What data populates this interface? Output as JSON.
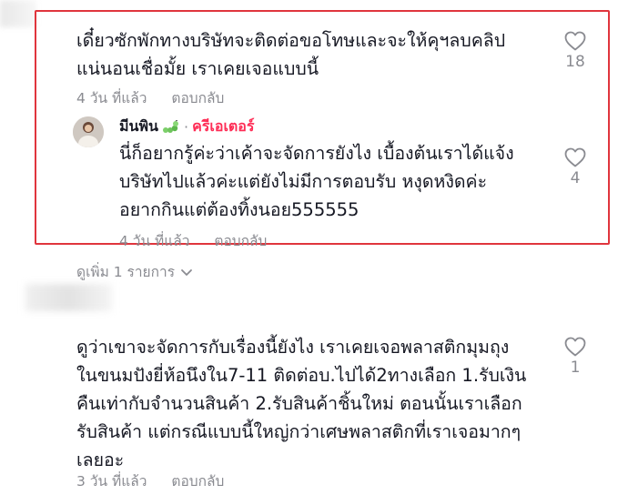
{
  "comment1": {
    "text_line1": "เดี๋ยวซักพักทางบริษัทจะติดต่อขอโทษและจะให้คุฯลบคลิป",
    "text_line2": "แน่นอนเชื่อมั้ย เราเคยเจอแบบนี้",
    "time": "4 วัน ที่แล้ว",
    "reply_label": "ตอบกลับ",
    "likes": "18"
  },
  "reply1": {
    "author": "มีนพิน",
    "separator": "·",
    "creator_badge": "ครีเอเตอร์",
    "text_line1": "นี่ก็อยากรู้ค่ะว่าเค้าจะจัดการยังไง เบื้องต้นเราได้แจ้ง",
    "text_line2": "บริษัทไปแล้วค่ะแต่ยังไม่มีการตอบรับ หงุดหงิดค่ะ",
    "text_line3": "อยากกินแต่ต้องทิ้งนอย555555",
    "time": "4 วัน ที่แล้ว",
    "reply_label": "ตอบกลับ",
    "likes": "4"
  },
  "view_more": {
    "label": "ดูเพิ่ม 1 รายการ"
  },
  "comment2": {
    "text_line1": "ดูว่าเขาจะจัดการกับเรื่องนี้ยังไง เราเคยเจอพลาสติกมุมถุง",
    "text_line2": "ในขนมปังยี่ห้อนึงใน7-11 ติดต่อบ.ไปได้2ทางเลือก 1.รับเงิน",
    "text_line3": "คืนเท่ากับจำนวนสินค้า 2.รับสินค้าชิ้นใหม่ ตอนนั้นเราเลือก",
    "text_line4": "รับสินค้า แต่กรณีแบบนี้ใหญ่กว่าเศษพลาสติกที่เราเจอมากๆ",
    "text_line5": "เลยอะ",
    "time": "3 วัน ที่แล้ว",
    "reply_label": "ตอบกลับ",
    "likes": "1"
  },
  "colors": {
    "highlight_border": "#e0353d",
    "creator_badge": "#fe2c55",
    "text": "#161823",
    "muted": "#8a8b91"
  },
  "icons": {
    "like": "heart-outline-icon",
    "creator": "caterpillar-emoji-icon",
    "expand": "chevron-down-icon"
  }
}
